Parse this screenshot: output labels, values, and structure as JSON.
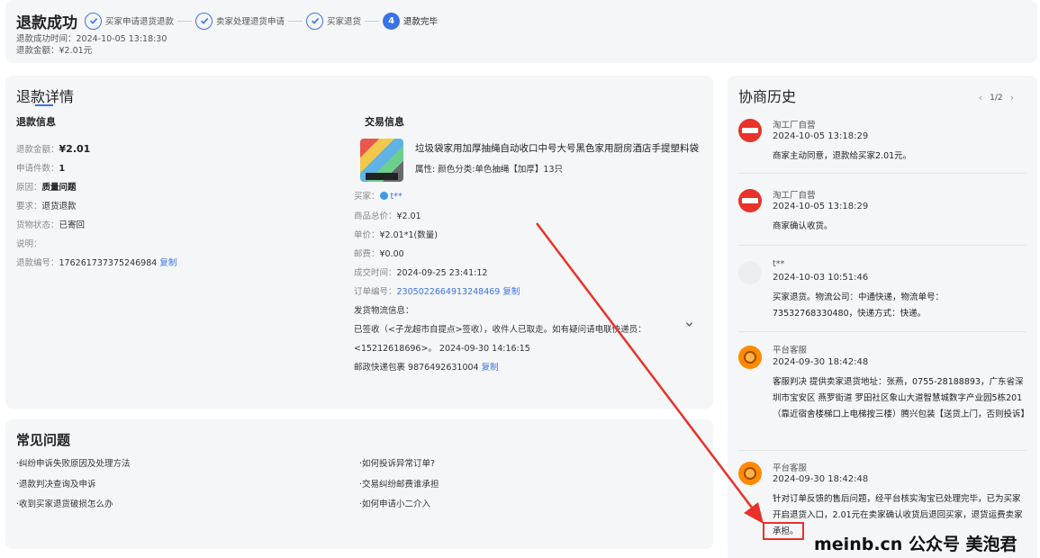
{
  "header": {
    "title": "退款成功",
    "steps": [
      "买家申请退货退款",
      "卖家处理退货申请",
      "买家退货",
      "退款完毕"
    ],
    "current_step_number": "4",
    "success_time": "退款成功时间：2024-10-05 13:18:30",
    "amount": "退款金额：¥2.01元"
  },
  "detail": {
    "title": "退款详情",
    "refund_info": {
      "heading": "退款信息",
      "rows": [
        {
          "k": "退款金额：",
          "v": "¥2.01"
        },
        {
          "k": "申请件数：",
          "v": "1"
        },
        {
          "k": "原因：",
          "v": "质量问题"
        },
        {
          "k": "要求：",
          "v": "退货退款"
        },
        {
          "k": "货物状态：",
          "v": "已寄回"
        },
        {
          "k": "说明：",
          "v": ""
        },
        {
          "k": "退款编号：",
          "v": "176261737375246984",
          "link": "复制"
        }
      ]
    },
    "trade_info": {
      "heading": "交易信息",
      "product_name": "垃圾袋家用加厚抽绳自动收口中号大号黑色家用厨房酒店手提塑料袋",
      "product_attr": "属性: 颜色分类:单色抽绳【加厚】13只",
      "buyer_label": "买家：",
      "buyer_name": "t**",
      "rows": [
        {
          "k": "商品总价：",
          "v": "¥2.01"
        },
        {
          "k": "单价：",
          "v": "¥2.01*1(数量)"
        },
        {
          "k": "邮费：",
          "v": "¥0.00"
        },
        {
          "k": "成交时间：",
          "v": "2024-09-25 23:41:12"
        }
      ],
      "order_label": "订单编号：",
      "order_no": "2305022664913248469",
      "order_copy": "复制",
      "logistics_label": "发货物流信息：",
      "logistics_line1": "已签收（<子龙超市自提点>签收），收件人已取走。如有疑问请电联快递员：",
      "logistics_line2": "<15212618696>。 2024-09-30 14:16:15",
      "tracking": "邮政快递包裹 9876492631004",
      "tracking_copy": "复制"
    }
  },
  "faq": {
    "title": "常见问题",
    "items": [
      "·纠纷申诉失败原因及处理方法",
      "·如何投诉异常订单?",
      "·退款判决查询及申诉",
      "·交易纠纷邮费谁承担",
      "·收到买家退货破损怎么办",
      "·如何申请小二介入"
    ]
  },
  "history": {
    "title": "协商历史",
    "page": "1/2",
    "prev": "‹",
    "next": "›",
    "entries": [
      {
        "name": "淘工厂自营",
        "time": "2024-10-05 13:18:29",
        "msg": "商家主动同意，退款给买家2.01元。"
      },
      {
        "name": "淘工厂自营",
        "time": "2024-10-05 13:18:29",
        "msg": "商家确认收货。"
      },
      {
        "name": "t**",
        "time": "2024-10-03 10:51:46",
        "msg": "买家退货。物流公司：中通快递，物流单号：73532768330480，快递方式：快递。"
      },
      {
        "name": "平台客服",
        "time": "2024-09-30 18:42:48",
        "msg": "客服判决 提供卖家退货地址：张燕，0755-28188893，广东省深圳市宝安区 燕罗街道 罗田社区象山大道智慧城数字产业园5栋201（靠近宿舍楼梯口上电梯按三楼）腾兴包装【送货上门，否则投诉】"
      },
      {
        "name": "平台客服",
        "time": "2024-09-30 18:42:48",
        "msg": "针对订单反馈的售后问题，经平台核实淘宝已处理完毕，已为买家开启退货入口，2.01元在卖家确认收货后退回买家，退货运费卖家承担。"
      }
    ]
  },
  "watermark": "meinb.cn 公众号 美泡君",
  "colors": {
    "accent": "#3a73e6",
    "annotation": "#e8322a",
    "card_bg": "#f5f6f8"
  }
}
